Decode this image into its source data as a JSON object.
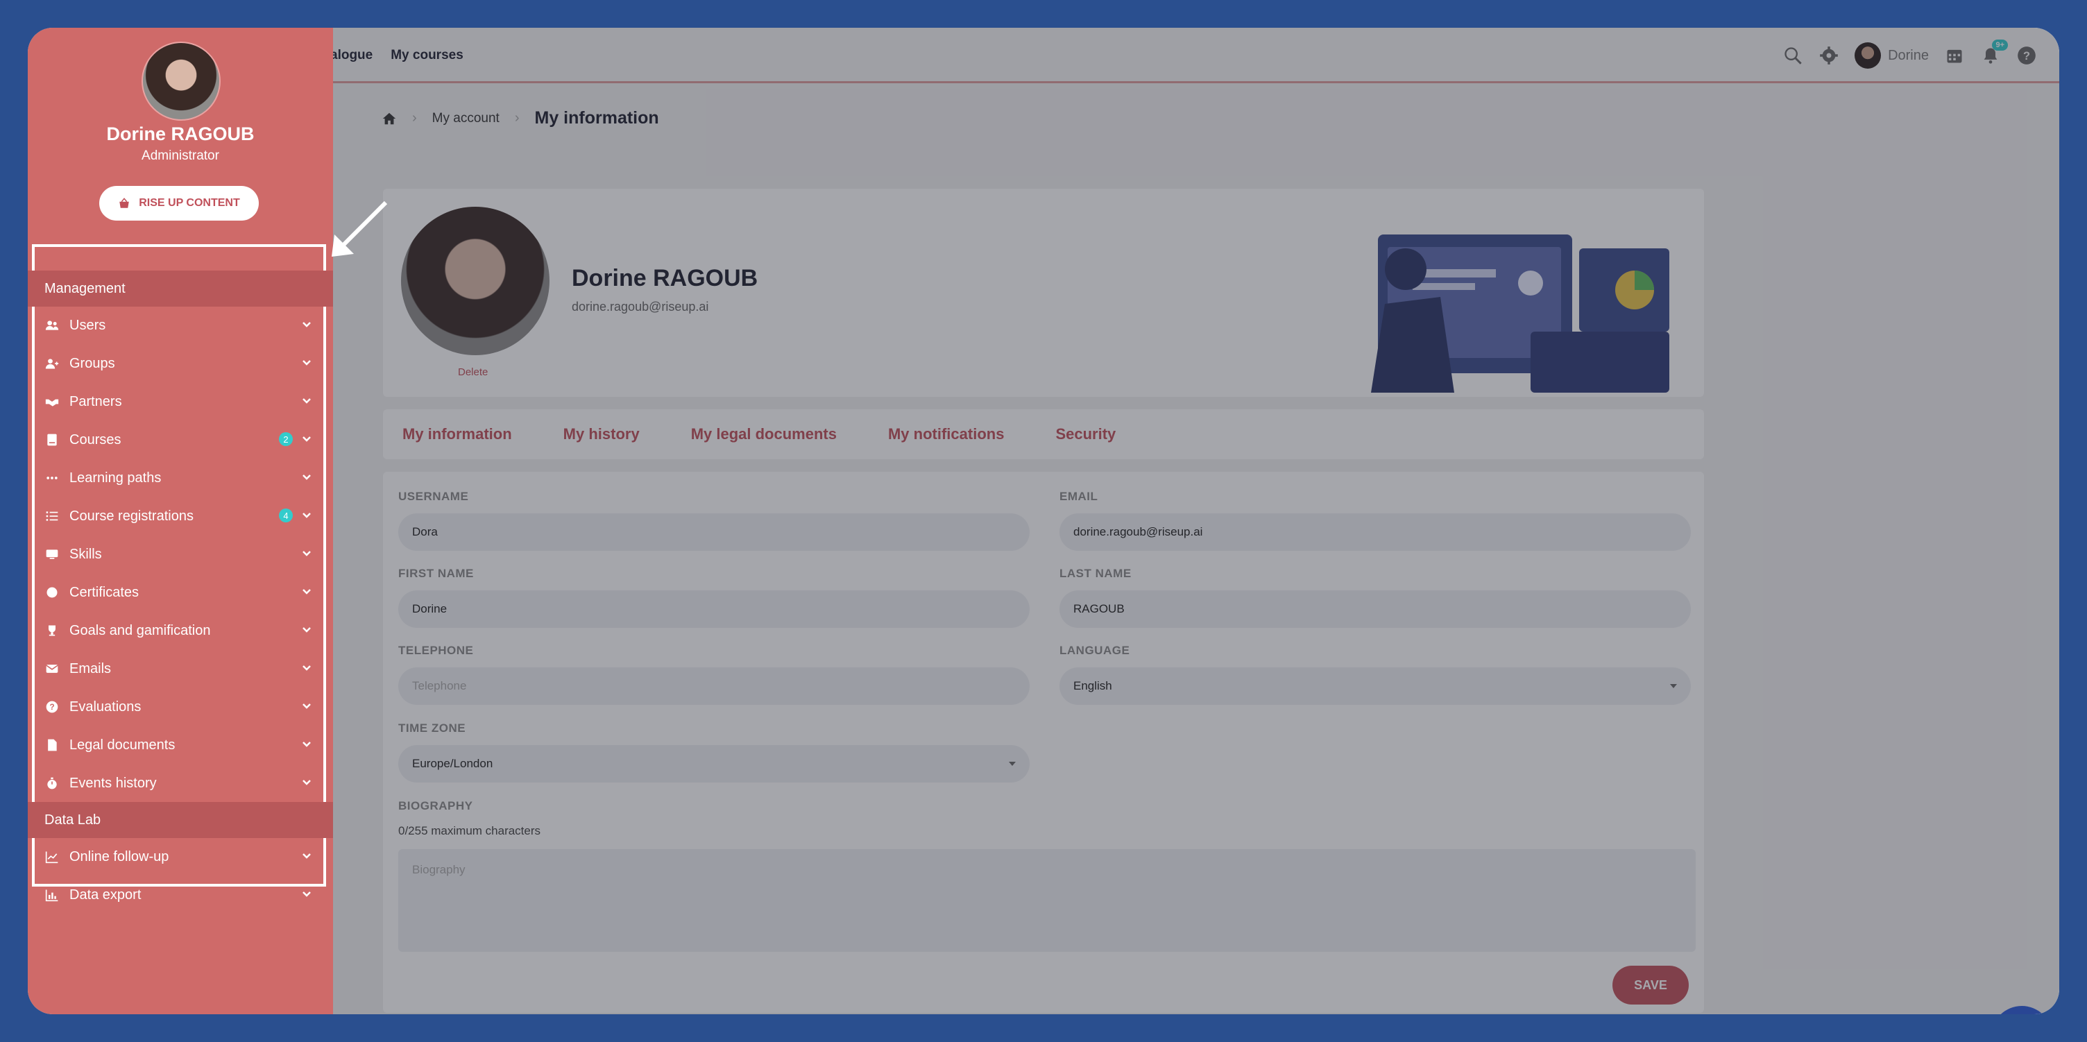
{
  "topbar": {
    "nav": [
      "alogue",
      "My courses"
    ],
    "user_name": "Dorine",
    "notif_badge": "9+"
  },
  "breadcrumb": {
    "level1": "My account",
    "current": "My information"
  },
  "profile": {
    "name": "Dorine RAGOUB",
    "email": "dorine.ragoub@riseup.ai",
    "delete_label": "Delete"
  },
  "tabs": [
    "My information",
    "My history",
    "My legal documents",
    "My notifications",
    "Security"
  ],
  "form": {
    "username": {
      "label": "USERNAME",
      "value": "Dora"
    },
    "email": {
      "label": "EMAIL",
      "value": "dorine.ragoub@riseup.ai"
    },
    "first_name": {
      "label": "FIRST NAME",
      "value": "Dorine"
    },
    "last_name": {
      "label": "LAST NAME",
      "value": "RAGOUB"
    },
    "telephone": {
      "label": "TELEPHONE",
      "placeholder": "Telephone"
    },
    "language": {
      "label": "LANGUAGE",
      "value": "English"
    },
    "timezone": {
      "label": "TIME ZONE",
      "value": "Europe/London"
    },
    "biography": {
      "label": "BIOGRAPHY",
      "counter": "0/255 maximum characters",
      "placeholder": "Biography"
    },
    "save_label": "SAVE"
  },
  "sidebar": {
    "name": "Dorine RAGOUB",
    "role": "Administrator",
    "button_label": "RISE UP CONTENT",
    "section_management": "Management",
    "section_datalab": "Data Lab",
    "items": [
      {
        "label": "Users",
        "icon": "users-icon"
      },
      {
        "label": "Groups",
        "icon": "group-icon"
      },
      {
        "label": "Partners",
        "icon": "handshake-icon"
      },
      {
        "label": "Courses",
        "icon": "book-icon",
        "count": "2"
      },
      {
        "label": "Learning paths",
        "icon": "dots-icon"
      },
      {
        "label": "Course registrations",
        "icon": "list-icon",
        "count": "4"
      },
      {
        "label": "Skills",
        "icon": "skills-icon"
      },
      {
        "label": "Certificates",
        "icon": "certificate-icon"
      },
      {
        "label": "Goals and gamification",
        "icon": "trophy-icon"
      },
      {
        "label": "Emails",
        "icon": "envelope-icon"
      },
      {
        "label": "Evaluations",
        "icon": "question-icon"
      },
      {
        "label": "Legal documents",
        "icon": "document-icon"
      },
      {
        "label": "Events history",
        "icon": "stopwatch-icon"
      },
      {
        "label": "Online follow-up",
        "icon": "line-chart-icon"
      },
      {
        "label": "Data export",
        "icon": "bar-chart-icon"
      }
    ]
  },
  "colors": {
    "sidebar_bg": "#cf6a69",
    "accent": "#c0505a",
    "badge": "#33cccc",
    "background": "#2a4f8f"
  }
}
